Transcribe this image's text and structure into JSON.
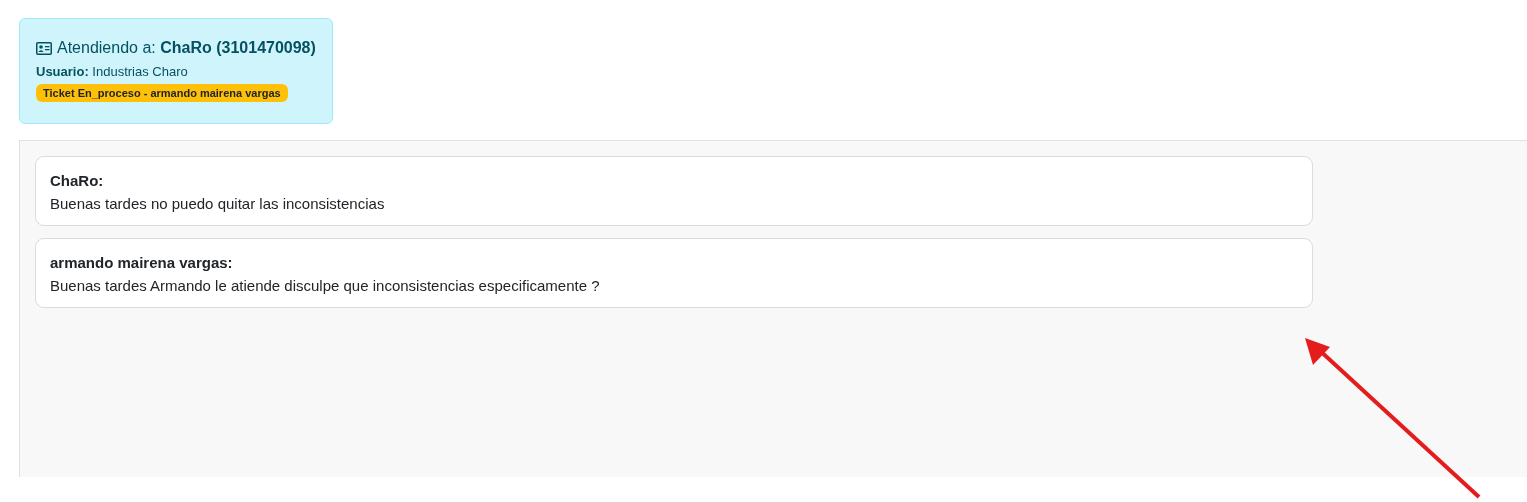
{
  "attending_card": {
    "title": "Atendiendo a: **ChaRo (3101470098)**",
    "user": "**Usuario:** Industrias Charo",
    "ticket_badge": "Ticket En_proceso - armando mairena vargas"
  },
  "messages": [
    {
      "author": "ChaRo:",
      "text": "Buenas tardes no puedo quitar las inconsistencias"
    },
    {
      "author": "armando mairena vargas:",
      "text": "Buenas tardes Armando le atiende disculpe que inconsistencias especificamente ?"
    }
  ]
}
